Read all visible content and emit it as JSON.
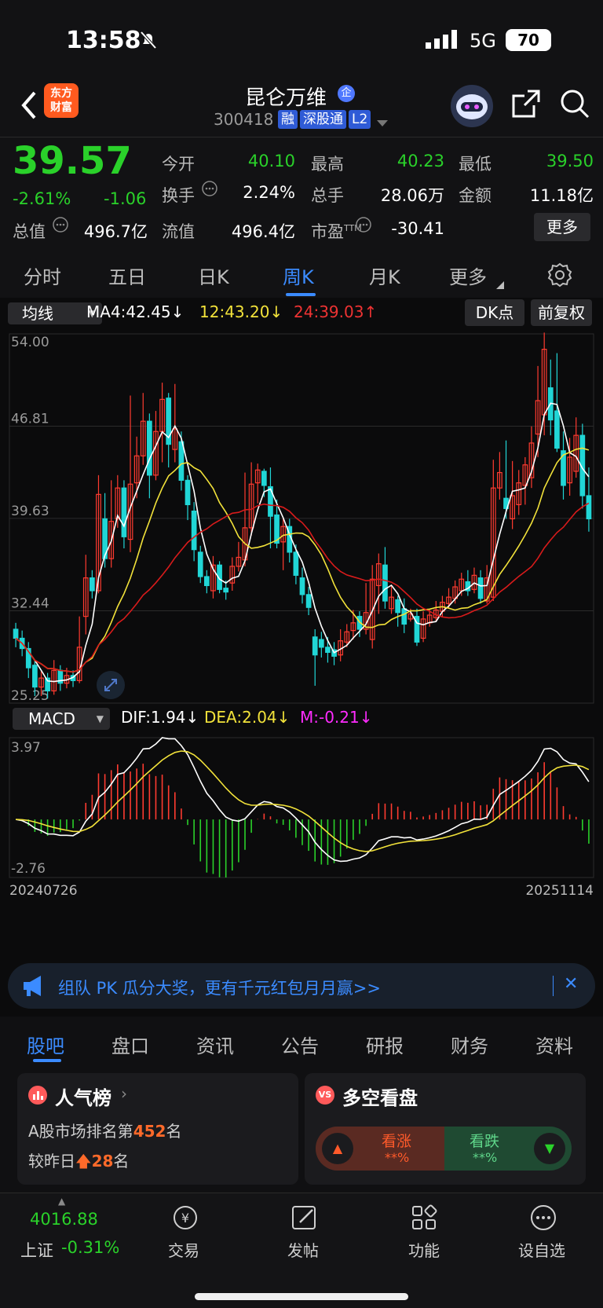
{
  "status_bar": {
    "time": "13:58",
    "network": "5G",
    "battery": "70"
  },
  "header": {
    "title": "昆仑万维",
    "title_badge": "企",
    "code": "300418",
    "tags": [
      "融",
      "深股通",
      "L2"
    ]
  },
  "quote": {
    "price": "39.57",
    "change_pct": "-2.61%",
    "change": "-1.06",
    "fields": {
      "open_label": "今开",
      "open": "40.10",
      "high_label": "最高",
      "high": "40.23",
      "low_label": "最低",
      "low": "39.50",
      "turnover_label": "换手",
      "turnover": "2.24%",
      "volume_label": "总手",
      "volume": "28.06万",
      "amount_label": "金额",
      "amount": "11.18亿",
      "mktcap_label": "总值",
      "mktcap": "496.7亿",
      "float_label": "流值",
      "float": "496.4亿",
      "pe_label": "市盈",
      "pe_sup": "TTM",
      "pe": "-30.41",
      "more": "更多"
    }
  },
  "chart_tabs": [
    "分时",
    "五日",
    "日K",
    "周K",
    "月K",
    "更多"
  ],
  "active_chart_tab": "周K",
  "ma_bar": {
    "selector": "均线",
    "ma4": "MA4:42.45",
    "ma4_arrow": "↓",
    "ma12": "12:43.20",
    "ma12_arrow": "↓",
    "ma24": "24:39.03",
    "ma24_arrow": "↑",
    "dk": "DK点",
    "adjust": "前复权"
  },
  "macd_bar": {
    "selector": "MACD",
    "dif": "DIF:1.94",
    "dif_arrow": "↓",
    "dea": "DEA:2.04",
    "dea_arrow": "↓",
    "m": "M:-0.21",
    "m_arrow": "↓"
  },
  "colors": {
    "up": "#ff3b30",
    "down": "#21d6d6",
    "ma4": "#ffffff",
    "ma12": "#f2e23a",
    "ma24": "#d81b1b",
    "accent": "#3b8bff",
    "macd_pos": "#ff3b30",
    "macd_neg": "#2ad12a",
    "macd_m": "#ff2bff"
  },
  "chart_data": [
    {
      "type": "candlestick",
      "ylim": [
        25.25,
        54.0
      ],
      "y_ticks": [
        "54.00",
        "46.81",
        "39.63",
        "32.44",
        "25.25"
      ],
      "x_start": "20240726",
      "x_end": "20251114",
      "candles": [
        [
          31.0,
          30.3,
          31.5,
          29.6
        ],
        [
          30.3,
          29.5,
          30.9,
          28.9
        ],
        [
          29.5,
          28.0,
          30.0,
          27.2
        ],
        [
          28.2,
          26.5,
          28.6,
          25.8
        ],
        [
          26.5,
          27.2,
          27.8,
          25.8
        ],
        [
          27.2,
          26.2,
          27.6,
          25.6
        ],
        [
          26.2,
          27.8,
          28.6,
          25.9
        ],
        [
          27.8,
          26.8,
          28.2,
          26.2
        ],
        [
          26.8,
          27.4,
          28.0,
          26.4
        ],
        [
          27.4,
          27.0,
          27.8,
          26.5
        ],
        [
          27.0,
          29.6,
          32.0,
          26.8
        ],
        [
          32.0,
          35.0,
          36.8,
          30.6
        ],
        [
          35.0,
          34.0,
          35.6,
          33.4
        ],
        [
          34.0,
          41.5,
          43.0,
          33.8
        ],
        [
          39.6,
          36.5,
          41.6,
          35.8
        ],
        [
          36.5,
          39.4,
          42.6,
          35.8
        ],
        [
          39.6,
          42.0,
          43.0,
          38.9
        ],
        [
          42.0,
          38.2,
          42.6,
          37.3
        ],
        [
          38.0,
          42.3,
          49.2,
          37.0
        ],
        [
          42.4,
          44.5,
          46.0,
          41.2
        ],
        [
          44.5,
          47.2,
          49.4,
          43.8
        ],
        [
          47.2,
          43.0,
          47.8,
          41.2
        ],
        [
          43.0,
          46.4,
          48.0,
          42.6
        ],
        [
          46.4,
          48.9,
          50.2,
          44.0
        ],
        [
          49.0,
          45.4,
          49.4,
          43.6
        ],
        [
          45.0,
          46.6,
          50.1,
          44.0
        ],
        [
          45.6,
          42.6,
          46.4,
          41.8
        ],
        [
          42.6,
          40.7,
          43.0,
          39.5
        ],
        [
          40.2,
          37.2,
          40.9,
          36.3
        ],
        [
          37.0,
          35.1,
          37.5,
          34.6
        ],
        [
          35.1,
          34.4,
          35.6,
          33.8
        ],
        [
          34.0,
          36.0,
          36.7,
          33.4
        ],
        [
          36.0,
          34.1,
          36.3,
          33.8
        ],
        [
          34.2,
          33.9,
          34.8,
          33.3
        ],
        [
          34.6,
          35.9,
          36.6,
          34.0
        ],
        [
          35.9,
          36.6,
          37.8,
          35.5
        ],
        [
          36.4,
          38.9,
          43.2,
          35.9
        ],
        [
          38.9,
          42.3,
          44.0,
          38.3
        ],
        [
          42.4,
          43.4,
          43.9,
          40.8
        ],
        [
          43.3,
          42.2,
          43.5,
          41.3
        ],
        [
          42.1,
          39.8,
          43.6,
          37.3
        ],
        [
          39.9,
          37.7,
          41.1,
          37.3
        ],
        [
          37.8,
          39.0,
          39.6,
          35.6
        ],
        [
          39.0,
          37.0,
          39.6,
          36.2
        ],
        [
          37.0,
          35.2,
          37.6,
          34.5
        ],
        [
          35.0,
          33.7,
          35.8,
          33.0
        ],
        [
          33.7,
          32.7,
          34.3,
          32.1
        ],
        [
          30.4,
          29.0,
          31.0,
          26.6
        ],
        [
          30.2,
          29.6,
          30.8,
          28.8
        ],
        [
          29.6,
          29.2,
          30.4,
          28.4
        ],
        [
          29.4,
          28.9,
          30.0,
          28.2
        ],
        [
          29.0,
          30.1,
          31.0,
          28.5
        ],
        [
          30.0,
          30.8,
          31.4,
          29.6
        ],
        [
          30.9,
          31.5,
          32.5,
          30.2
        ],
        [
          32.0,
          31.0,
          32.4,
          30.4
        ],
        [
          31.0,
          32.3,
          34.6,
          30.6
        ],
        [
          30.2,
          34.9,
          36.0,
          29.5
        ],
        [
          34.4,
          36.1,
          36.9,
          32.2
        ],
        [
          36.0,
          33.2,
          37.4,
          32.6
        ],
        [
          32.6,
          33.5,
          34.4,
          32.2
        ],
        [
          33.3,
          32.3,
          33.6,
          31.2
        ],
        [
          32.6,
          31.4,
          33.4,
          30.7
        ],
        [
          31.8,
          32.2,
          32.6,
          31.6
        ],
        [
          32.0,
          30.0,
          32.6,
          29.7
        ],
        [
          30.3,
          31.8,
          32.4,
          30.0
        ],
        [
          31.5,
          32.1,
          32.6,
          31.2
        ],
        [
          31.9,
          32.5,
          33.2,
          31.6
        ],
        [
          32.4,
          33.1,
          33.6,
          32.0
        ],
        [
          33.0,
          33.5,
          34.2,
          32.6
        ],
        [
          33.4,
          34.3,
          34.8,
          33.0
        ],
        [
          34.0,
          34.9,
          35.4,
          33.6
        ],
        [
          34.7,
          34.0,
          35.6,
          33.6
        ],
        [
          34.1,
          35.2,
          35.8,
          33.8
        ],
        [
          35.0,
          33.4,
          35.6,
          33.0
        ],
        [
          33.2,
          35.0,
          36.0,
          33.0
        ],
        [
          33.5,
          42.0,
          44.2,
          33.2
        ],
        [
          42.0,
          43.2,
          44.8,
          41.1
        ],
        [
          41.2,
          40.4,
          45.7,
          39.6
        ],
        [
          39.6,
          41.4,
          44.1,
          38.8
        ],
        [
          40.7,
          42.4,
          43.4,
          39.9
        ],
        [
          42.2,
          43.8,
          44.4,
          40.7
        ],
        [
          42.8,
          45.5,
          46.8,
          42.0
        ],
        [
          46.2,
          48.8,
          51.5,
          44.4
        ],
        [
          47.7,
          52.8,
          54.1,
          46.1
        ],
        [
          49.8,
          47.3,
          52.0,
          46.1
        ],
        [
          48.0,
          45.1,
          52.5,
          44.8
        ],
        [
          44.9,
          42.2,
          46.4,
          41.1
        ],
        [
          42.4,
          44.4,
          45.9,
          41.4
        ],
        [
          43.3,
          46.1,
          47.5,
          42.8
        ],
        [
          46.1,
          41.4,
          47.0,
          40.4
        ],
        [
          41.4,
          39.6,
          43.6,
          38.6
        ]
      ]
    },
    {
      "type": "macd",
      "ylim": [
        -2.76,
        3.97
      ],
      "y_ticks": [
        "3.97",
        "-2.76"
      ],
      "bars_count": 91,
      "dif": {
        "name": "DIF",
        "value": "1.94"
      },
      "dea": {
        "name": "DEA",
        "value": "2.04"
      },
      "m": {
        "name": "M",
        "value": "-0.21"
      }
    }
  ],
  "banner": {
    "text": "组队 PK 瓜分大奖，更有千元红包月月赢>>",
    "close": "✕"
  },
  "sub_tabs": [
    "股吧",
    "盘口",
    "资讯",
    "公告",
    "研报",
    "财务",
    "资料"
  ],
  "active_sub_tab": "股吧",
  "popularity_card": {
    "title": "人气榜",
    "line1_prefix": "A股市场排名第",
    "rank": "452",
    "line1_suffix": "名",
    "line2_prefix": "较昨日",
    "delta": "28",
    "line2_suffix": "名"
  },
  "sentiment_card": {
    "title": "多空看盘",
    "bull_label": "看涨",
    "bull_value": "**%",
    "bear_label": "看跌",
    "bear_value": "**%",
    "badge": "VS"
  },
  "bottom_nav": {
    "index_value": "4016.88",
    "index_name": "上证",
    "index_change": "-0.31%",
    "items": [
      "交易",
      "发帖",
      "功能",
      "设自选"
    ]
  }
}
